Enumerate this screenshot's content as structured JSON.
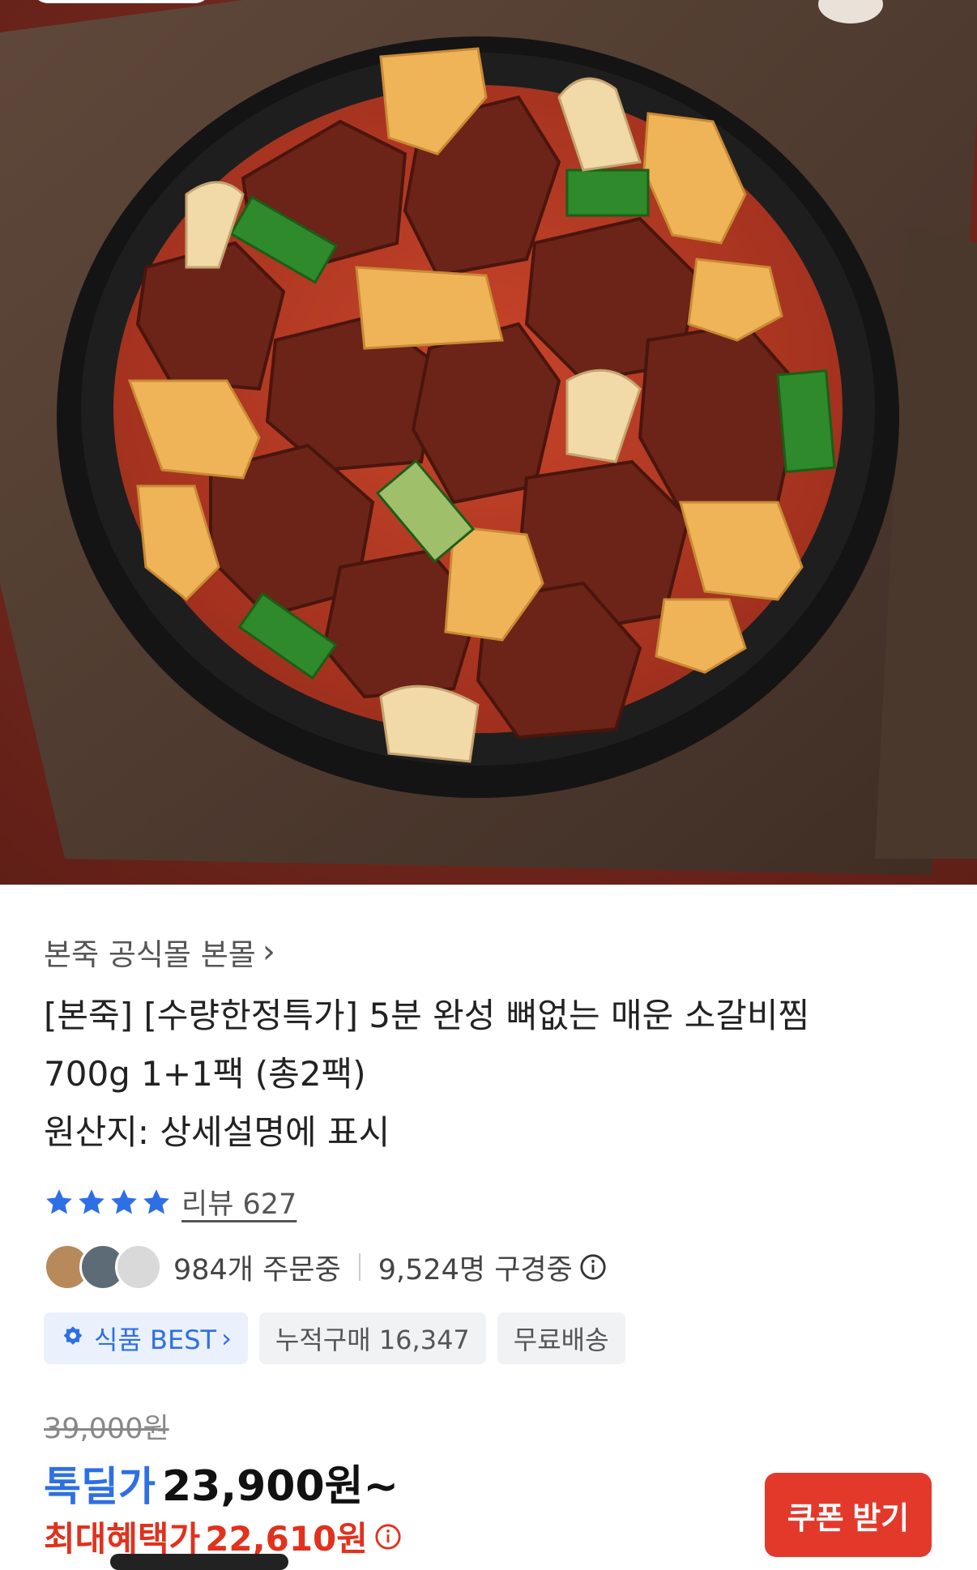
{
  "store": {
    "name": "본죽 공식몰 본몰",
    "chevron": "›"
  },
  "product": {
    "title_line1": "[본죽] [수량한정특가] 5분 완성 뼈없는 매운 소갈비찜",
    "title_line2": "700g 1+1팩 (총2팩)",
    "origin": "원산지: 상세설명에 표시"
  },
  "rating": {
    "stars": 4,
    "review_label": "리뷰 627"
  },
  "social": {
    "ordering": "984개 주문중",
    "watching": "9,524명 구경중"
  },
  "badges": {
    "best_label": "식품 BEST",
    "best_chevron": "›",
    "cumulative": "누적구매 16,347",
    "shipping": "무료배송"
  },
  "price": {
    "original": "39,000원",
    "deal_label": "톡딜가",
    "deal_price": "23,900원~",
    "max_label": "최대혜택가",
    "max_price": "22,610원"
  },
  "coupon_button": "쿠폰 받기",
  "icons": {
    "star": "star-icon",
    "info": "info-icon",
    "best": "gear-badge-icon",
    "chevron": "chevron-right-icon"
  },
  "colors": {
    "accent_blue": "#2f6fe4",
    "accent_red": "#e0321d",
    "button_red": "#e3392b",
    "star_blue": "#2f6fe4"
  }
}
